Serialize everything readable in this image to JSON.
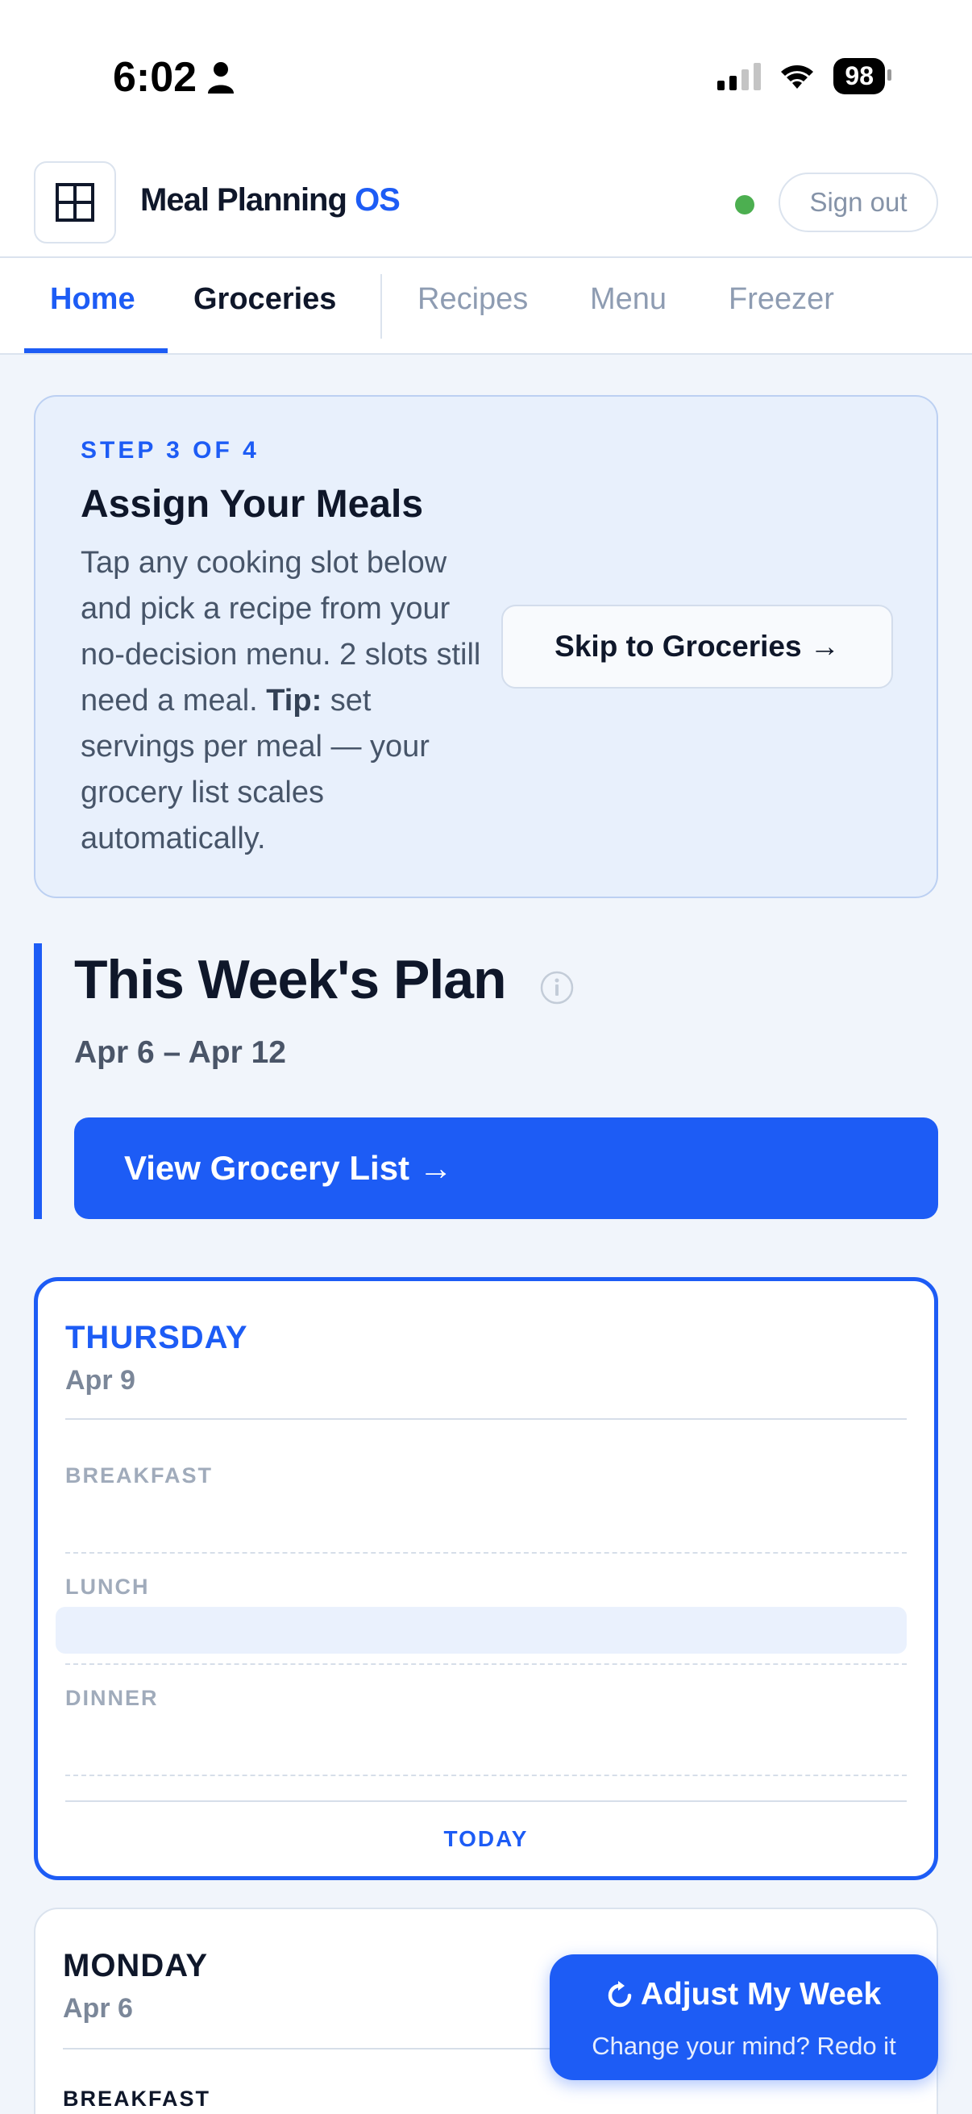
{
  "status_bar": {
    "time": "6:02",
    "battery": "98"
  },
  "header": {
    "title_main": "Meal Planning",
    "title_accent": "OS",
    "signout_label": "Sign out"
  },
  "tabs": [
    {
      "label": "Home"
    },
    {
      "label": "Groceries"
    },
    {
      "label": "Recipes"
    },
    {
      "label": "Menu"
    },
    {
      "label": "Freezer"
    }
  ],
  "step_card": {
    "step": "STEP 3 OF 4",
    "title": "Assign Your Meals",
    "desc_before": "Tap any cooking slot below and pick a recipe from your no-decision menu. 2 slots still need a meal.",
    "tip_label": "Tip:",
    "desc_after": "set servings per meal — your grocery list scales automatically.",
    "skip_label": "Skip to Groceries →"
  },
  "week": {
    "title": "This Week's Plan",
    "range": "Apr 6 – Apr 12",
    "grocery_button": "View Grocery List →"
  },
  "days": [
    {
      "name": "THURSDAY",
      "date": "Apr 9",
      "meals": [
        "BREAKFAST",
        "LUNCH",
        "DINNER"
      ],
      "footer": "TODAY"
    },
    {
      "name": "MONDAY",
      "date": "Apr 6",
      "meals": [
        "BREAKFAST"
      ]
    }
  ],
  "fab": {
    "title": "Adjust My Week",
    "subtitle": "Change your mind? Redo it"
  },
  "colors": {
    "accent": "#1d5cf5",
    "online": "#4caf50"
  }
}
